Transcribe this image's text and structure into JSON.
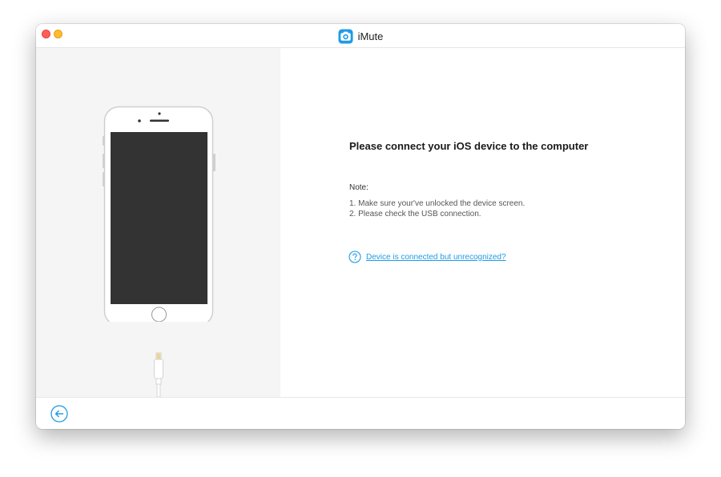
{
  "window": {
    "title": "iMute"
  },
  "main": {
    "heading": "Please connect your iOS device to the computer",
    "note_label": "Note:",
    "notes": [
      "1. Make sure your've unlocked the device screen.",
      "2. Please check the USB connection."
    ],
    "help_link": "Device is connected but unrecognized?"
  },
  "icons": {
    "app_logo": "camera-logo-icon",
    "help": "question-circle-icon",
    "back": "arrow-left-circle-icon"
  },
  "colors": {
    "accent": "#1e9be5",
    "left_panel_bg": "#f5f5f5",
    "phone_screen": "#333333",
    "close": "#fe5f57",
    "minimize": "#febc2e"
  }
}
